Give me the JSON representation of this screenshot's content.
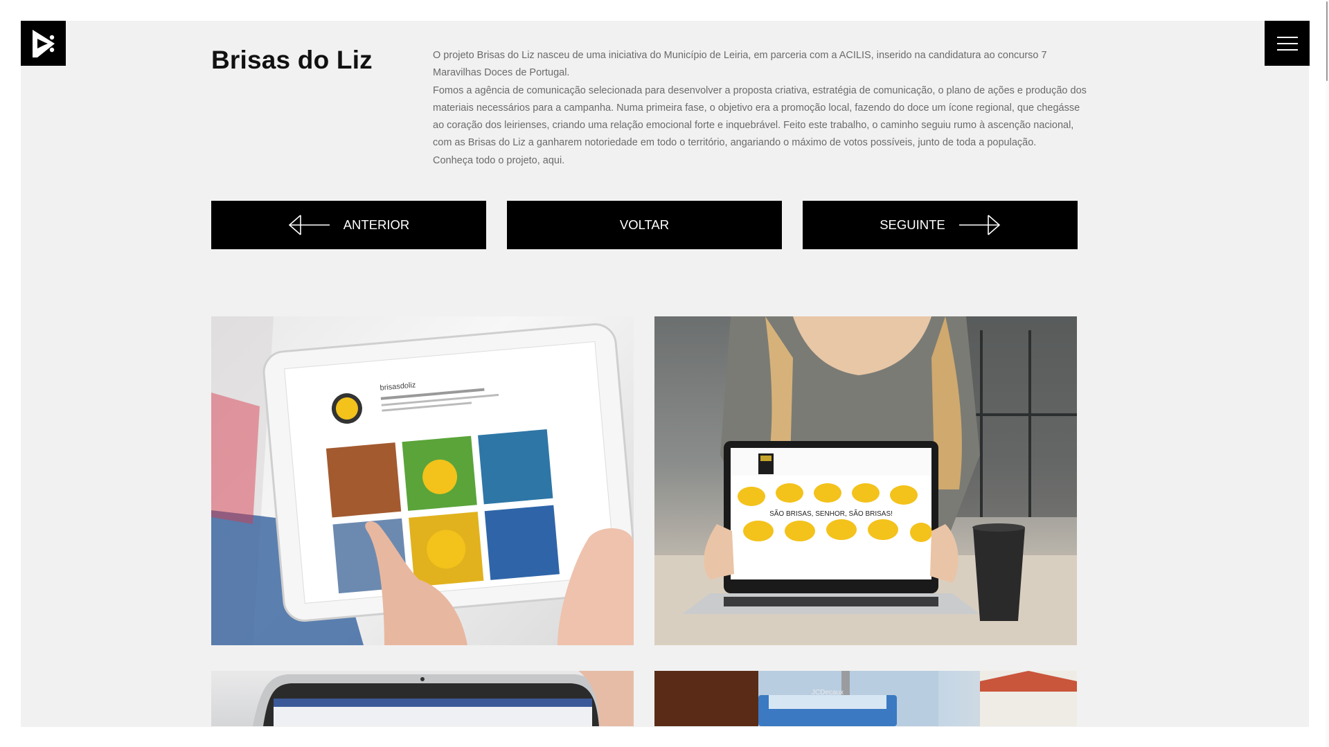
{
  "brand": {
    "logo_icon": "agency-logo-icon"
  },
  "header": {
    "menu_icon": "hamburger-menu-icon"
  },
  "project": {
    "title": "Brisas do Liz",
    "paragraphs": [
      "O projeto Brisas do Liz nasceu de uma iniciativa do Município de Leiria, em parceria com a ACILIS, inserido na candidatura ao concurso 7 Maravilhas Doces de Portugal.",
      "Fomos a agência de comunicação selecionada para desenvolver a proposta criativa, estratégia de comunicação, o plano de ações e produção dos materiais necessários para a campanha. Numa primeira fase, o objetivo era a promoção local, fazendo do doce um ícone regional, que chegásse ao coração dos leirienses, criando uma relação emocional forte e inquebrável. Feito este trabalho, o caminho seguiu rumo à ascenção nacional, com as Brisas do Liz a ganharem notoriedade em todo o território, angariando o máximo de votos possíveis, junto de toda a população.",
      "Conheça todo o projeto, aqui."
    ]
  },
  "navigation": {
    "previous_label": "ANTERIOR",
    "back_label": "VOLTAR",
    "next_label": "SEGUINTE"
  },
  "gallery": {
    "tiles": [
      {
        "name": "tablet-instagram-photo",
        "label": "brisasdoliz"
      },
      {
        "name": "laptop-website-photo",
        "label": "SÃO BRISAS, SENHOR, SÃO BRISAS!"
      },
      {
        "name": "laptop-facebook-photo"
      },
      {
        "name": "outdoor-billboard-photo",
        "label": "JCDecaux"
      }
    ]
  },
  "colors": {
    "background": "#f1f1f1",
    "button": "#000000",
    "text": "#6a6a6a",
    "title": "#111111",
    "accent_yellow": "#f3c21b"
  }
}
